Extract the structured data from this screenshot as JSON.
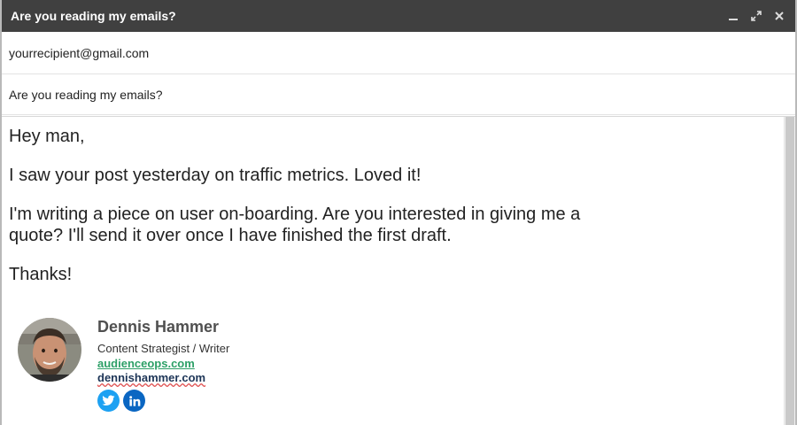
{
  "window": {
    "title": "Are you reading my emails?",
    "controls": [
      "minimize-icon",
      "popout-icon",
      "close-icon"
    ]
  },
  "compose": {
    "to": "yourrecipient@gmail.com",
    "subject": "Are you reading my emails?"
  },
  "message": {
    "greeting": "Hey man,",
    "para1": "I saw your post yesterday on traffic metrics. Loved it!",
    "para2": "I'm writing a piece on user on-boarding. Are you interested in giving me a quote? I'll send it over once I have finished the first draft.",
    "closing": "Thanks!"
  },
  "signature": {
    "name": "Dennis Hammer",
    "role": "Content Strategist / Writer",
    "link1": "audienceops.com",
    "link2": "dennishammer.com",
    "social_icons": [
      "twitter-icon",
      "linkedin-icon"
    ]
  },
  "colors": {
    "titlebar": "#404040",
    "link_green": "#2da067",
    "link_navy": "#1d3557",
    "twitter_blue": "#1da1f2",
    "linkedin_blue": "#0a66c2"
  }
}
